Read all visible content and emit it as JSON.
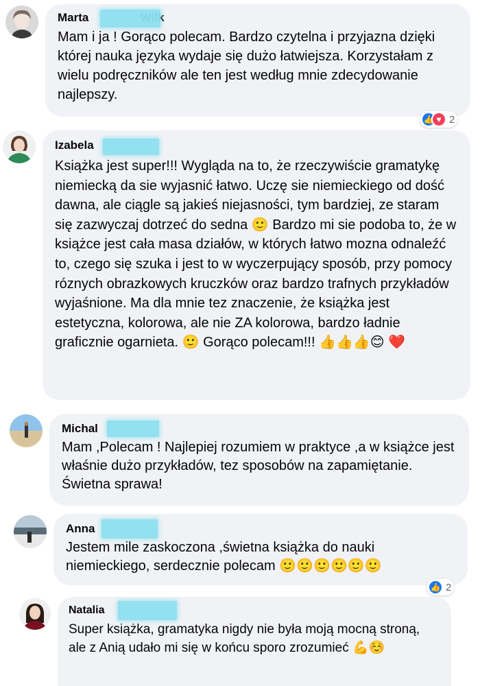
{
  "comments": [
    {
      "name": "Marta",
      "name_suffix": "Wilk",
      "text": "Mam i ja ! Gorąco polecam. Bardzo czytelna i przyjazna dzięki której nauka języka wydaje się dużo łatwiejsza. Korzystałam z wielu podręczników ale ten jest według mnie zdecydowanie najlepszy.",
      "reaction_count": "2"
    },
    {
      "name": "Izabela",
      "text": "Książka jest super!!! Wygląda na to, że rzeczywiście gramatykę niemiecką da sie wyjasnić łatwo. Uczę sie niemieckiego od dość dawna, ale ciągle są jakieś niejasności, tym bardziej, ze staram się zazwyczaj dotrzeć do sedna 🙂 Bardzo mi sie podoba to, że w książce jest cała masa działów, w których łatwo mozna odnaleźć to, czego się szuka i jest to w wyczerpujący sposób, przy pomocy róznych obrazkowych kruczków oraz bardzo trafnych przykładów wyjaśnione. Ma dla mnie tez znaczenie, że książka jest estetyczna, kolorowa, ale nie ZA kolorowa, bardzo ładnie graficznie ogarnieta. 🙂 Gorąco polecam!!! 👍👍👍😊 ❤️"
    },
    {
      "name": "Michal",
      "text": "Mam ,Polecam ! Najlepiej rozumiem w praktyce ,a w książce jest właśnie dużo przykładów, tez sposobów na zapamiętanie. Świetna sprawa!"
    },
    {
      "name": "Anna",
      "text": "Jestem mile zaskoczona ,świetna książka do nauki niemieckiego, serdecznie polecam 🙂🙂🙂🙂🙂🙂",
      "reaction_count": "2"
    },
    {
      "name": "Natalia",
      "text": "Super książka, gramatyka nigdy nie była moją mocną stroną, ale z Anią udało mi się w końcu sporo zrozumieć 💪☺️"
    }
  ],
  "icons": {
    "like": "thumbs-up-icon",
    "love": "heart-icon"
  },
  "colors": {
    "bubble": "#f0f2f5",
    "like": "#1877f2",
    "love": "#f33e58",
    "redaction": "#8fe0f0"
  }
}
